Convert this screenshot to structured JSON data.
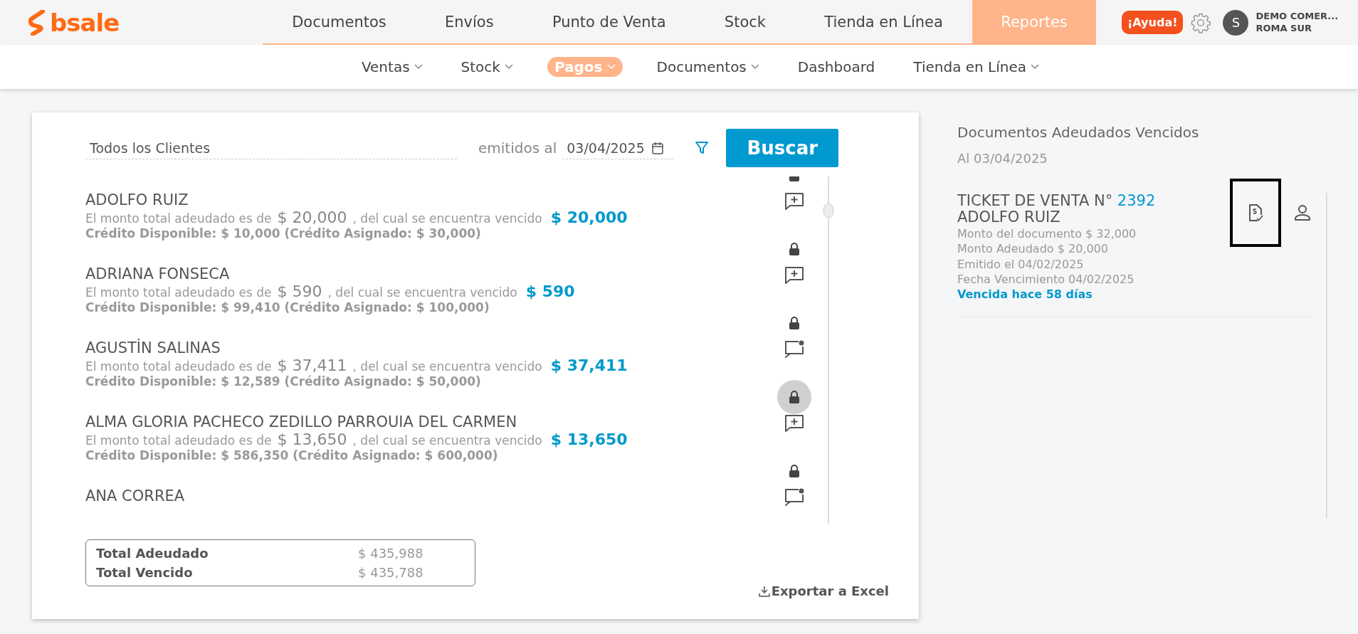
{
  "header": {
    "logo": "bsale",
    "nav": [
      {
        "label": "Documentos",
        "selected": false
      },
      {
        "label": "Envíos",
        "selected": false
      },
      {
        "label": "Punto de Venta",
        "selected": false
      },
      {
        "label": "Stock",
        "selected": false
      },
      {
        "label": "Tienda en Línea",
        "selected": false
      },
      {
        "label": "Reportes",
        "selected": true
      }
    ],
    "help_button": "¡Ayuda!",
    "user": {
      "avatar": "S",
      "company": "DEMO COMER...",
      "branch": "ROMA SUR"
    }
  },
  "subnav": [
    {
      "label": "Ventas",
      "dropdown": true,
      "selected": false
    },
    {
      "label": "Stock",
      "dropdown": true,
      "selected": false
    },
    {
      "label": "Pagos",
      "dropdown": true,
      "selected": true
    },
    {
      "label": "Documentos",
      "dropdown": true,
      "selected": false
    },
    {
      "label": "Dashboard",
      "dropdown": false,
      "selected": false
    },
    {
      "label": "Tienda en Línea",
      "dropdown": true,
      "selected": false
    }
  ],
  "filters": {
    "client": "Todos los Clientes",
    "date_label": "emitidos al",
    "date": "03/04/2025",
    "search_button": "Buscar"
  },
  "clients": [
    {
      "name": "ADOLFO RUIZ",
      "owed_label": "El monto total adeudado es de",
      "owed": "$ 20,000",
      "overdue_label": ", del cual se encuentra vencido",
      "overdue": "$ 20,000",
      "credit": "Crédito Disponible: $ 10,000 (Crédito Asignado: $ 30,000)",
      "comment_unread": false,
      "lock_highlighted": false
    },
    {
      "name": "ADRIANA FONSECA",
      "owed_label": "El monto total adeudado es de",
      "owed": "$ 590",
      "overdue_label": ", del cual se encuentra vencido",
      "overdue": "$ 590",
      "credit": "Crédito Disponible: $ 99,410 (Crédito Asignado: $ 100,000)",
      "comment_unread": false,
      "lock_highlighted": false
    },
    {
      "name": "AGUSTİN SALINAS",
      "owed_label": "El monto total adeudado es de",
      "owed": "$ 37,411",
      "overdue_label": ", del cual se encuentra vencido",
      "overdue": "$ 37,411",
      "credit": "Crédito Disponible: $ 12,589 (Crédito Asignado: $ 50,000)",
      "comment_unread": true,
      "lock_highlighted": false
    },
    {
      "name": "ALMA GLORIA PACHECO ZEDILLO PARROUIA DEL CARMEN",
      "owed_label": "El monto total adeudado es de",
      "owed": "$ 13,650",
      "overdue_label": ", del cual se encuentra vencido",
      "overdue": "$ 13,650",
      "credit": "Crédito Disponible: $ 586,350 (Crédito Asignado: $ 600,000)",
      "comment_unread": false,
      "lock_highlighted": true
    },
    {
      "name": "ANA CORREA",
      "comment_unread": true,
      "lock_highlighted": false
    }
  ],
  "totals": [
    {
      "label": "Total Adeudado",
      "value": "$ 435,988"
    },
    {
      "label": "Total Vencido",
      "value": "$ 435,788"
    }
  ],
  "export_link": "Exportar a Excel",
  "overdue_panel": {
    "title": "Documentos Adeudados Vencidos",
    "date": "Al 03/04/2025",
    "documents": [
      {
        "type_label": "TICKET DE VENTA N°",
        "number": "2392",
        "client": "ADOLFO RUIZ",
        "lines": [
          "Monto del documento $ 32,000",
          "Monto Adeudado $ 20,000",
          "Emitido el 04/02/2025",
          "Fecha Vencimiento 04/02/2025"
        ],
        "status": "Vencida hace 58 días",
        "focused": true
      }
    ]
  }
}
